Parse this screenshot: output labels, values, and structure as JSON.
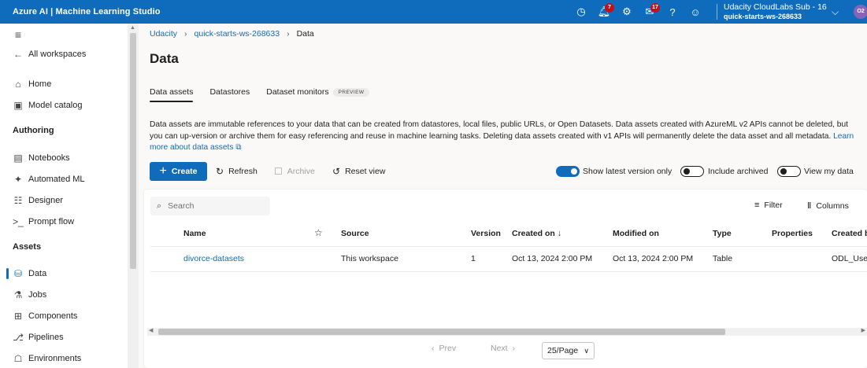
{
  "topbar": {
    "title": "Azure AI | Machine Learning Studio",
    "notifications_count": "7",
    "feedback_count": "17",
    "subscription": "Udacity CloudLabs Sub - 16",
    "workspace": "quick-starts-ws-268633",
    "avatar_initials": "O2",
    "icons": [
      "clock-icon",
      "bell-icon",
      "gear-icon",
      "megaphone-icon",
      "help-icon",
      "smiley-icon"
    ]
  },
  "sidebar": {
    "all_workspaces": "All workspaces",
    "home": "Home",
    "model_catalog": "Model catalog",
    "authoring_header": "Authoring",
    "notebooks": "Notebooks",
    "automated_ml": "Automated ML",
    "designer": "Designer",
    "prompt_flow": "Prompt flow",
    "assets_header": "Assets",
    "data": "Data",
    "jobs": "Jobs",
    "components": "Components",
    "pipelines": "Pipelines",
    "environments": "Environments"
  },
  "breadcrumb": {
    "org": "Udacity",
    "workspace": "quick-starts-ws-268633",
    "current": "Data"
  },
  "page": {
    "title": "Data",
    "tabs": {
      "data_assets": "Data assets",
      "datastores": "Datastores",
      "dataset_monitors": "Dataset monitors",
      "preview": "PREVIEW"
    },
    "description": "Data assets are immutable references to your data that can be created from datastores, local files, public URLs, or Open Datasets. Data assets created with AzureML v2 APIs cannot be deleted, but you can up-version or archive them for easy referencing and reuse in machine learning tasks. Deleting data assets created with v1 APIs will permanently delete the data asset and all metadata.",
    "learn_more": "Learn more about data assets"
  },
  "toolbar": {
    "create": "Create",
    "refresh": "Refresh",
    "archive": "Archive",
    "reset_view": "Reset view",
    "show_latest": "Show latest version only",
    "include_archived": "Include archived",
    "view_my_data": "View my data"
  },
  "grid": {
    "search_placeholder": "Search",
    "filter": "Filter",
    "columns": "Columns",
    "headers": {
      "name": "Name",
      "source": "Source",
      "version": "Version",
      "created_on": "Created on ↓",
      "modified_on": "Modified on",
      "type": "Type",
      "properties": "Properties",
      "created_by": "Created b"
    },
    "rows": [
      {
        "name": "divorce-datasets",
        "source": "This workspace",
        "version": "1",
        "created_on": "Oct 13, 2024 2:00 PM",
        "modified_on": "Oct 13, 2024 2:00 PM",
        "type": "Table",
        "properties": "",
        "created_by": "ODL_User"
      }
    ]
  },
  "pagination": {
    "prev": "Prev",
    "next": "Next",
    "page_size": "25/Page"
  }
}
